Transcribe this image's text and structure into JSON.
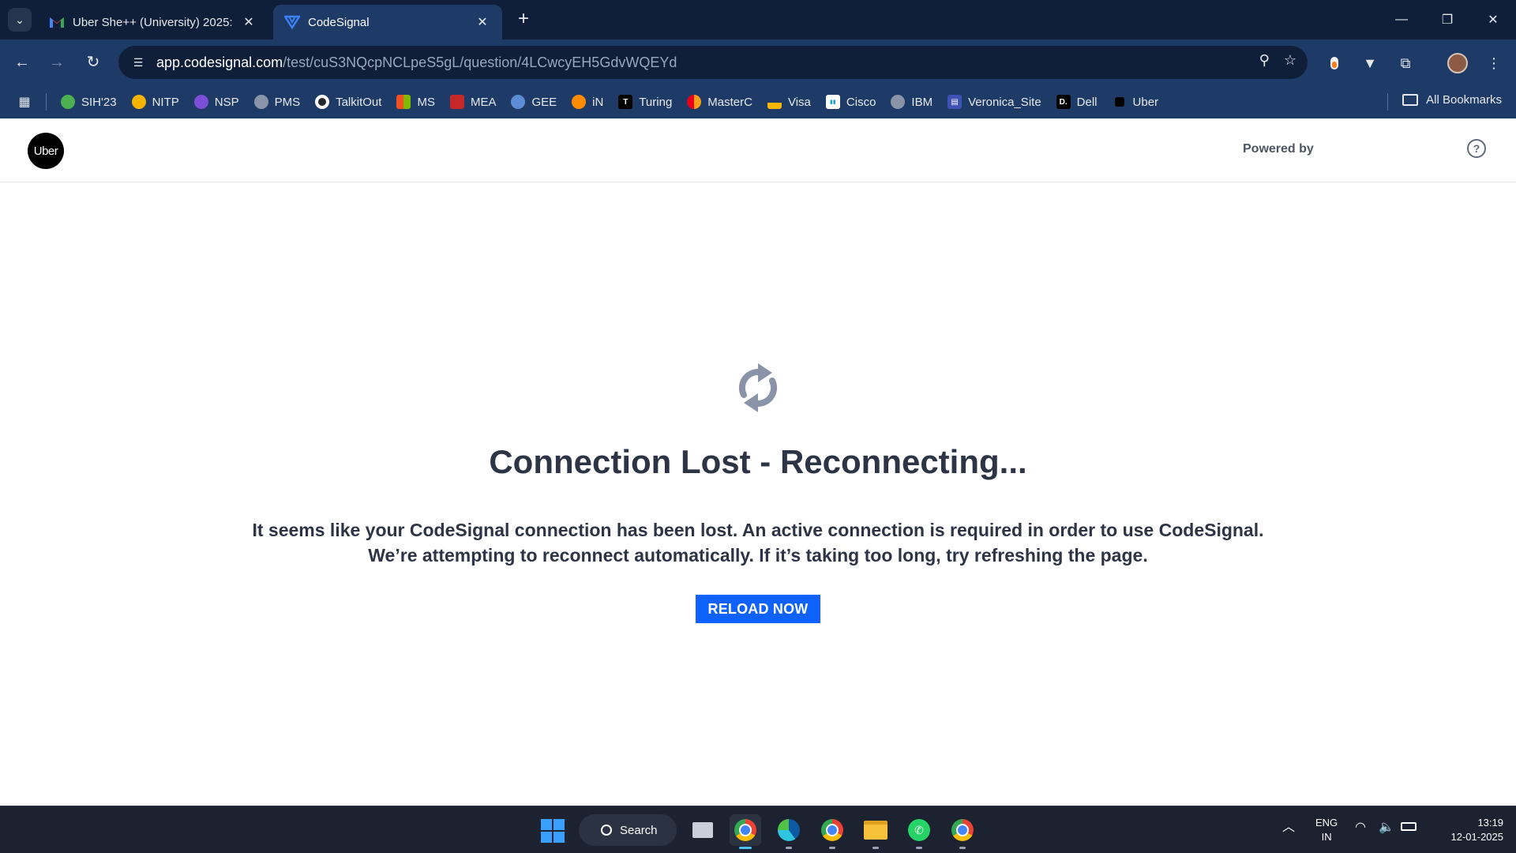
{
  "browser": {
    "tabs": [
      {
        "title": "Uber She++ (University) 2025: ",
        "active": false
      },
      {
        "title": "CodeSignal",
        "active": true
      }
    ],
    "url": {
      "host": "app.codesignal.com",
      "path": "/test/cuS3NQcpNCLpeS5gL/question/4LCwcyEH5GdvWQEYd"
    },
    "bookmarks": [
      {
        "label": "SIH'23",
        "color": "#4caf50"
      },
      {
        "label": "NITP",
        "color": "#f5b400"
      },
      {
        "label": "NSP",
        "color": "#7b4fd6"
      },
      {
        "label": "PMS",
        "color": "#8a94a8"
      },
      {
        "label": "TalkitOut",
        "color": "#24292e"
      },
      {
        "label": "MS",
        "color": "#f25022"
      },
      {
        "label": "MEA",
        "color": "#c62828"
      },
      {
        "label": "GEE",
        "color": "#5c8dd6"
      },
      {
        "label": "iN",
        "color": "#ff8c00"
      },
      {
        "label": "Turing",
        "color": "#000000"
      },
      {
        "label": "MasterC",
        "color": "#eb001b"
      },
      {
        "label": "Visa",
        "color": "#f7b600"
      },
      {
        "label": "Cisco",
        "color": "#1ba0d7"
      },
      {
        "label": "IBM",
        "color": "#8a94a8"
      },
      {
        "label": "Veronica_Site",
        "color": "#3f51b5"
      },
      {
        "label": "Dell",
        "color": "#000000"
      },
      {
        "label": "Uber",
        "color": "#000000"
      }
    ],
    "all_bookmarks": "All Bookmarks"
  },
  "page": {
    "logo_text": "Uber",
    "powered_by": "Powered by",
    "heading": "Connection Lost - Reconnecting...",
    "message_line1": "It seems like your CodeSignal connection has been lost. An active connection is required in order to use CodeSignal.",
    "message_line2": "We’re attempting to reconnect automatically. If it’s taking too long, try refreshing the page.",
    "reload_button": "RELOAD NOW",
    "accent_color": "#1062fe"
  },
  "taskbar": {
    "search_label": "Search",
    "language": "ENG",
    "region": "IN",
    "time": "13:19",
    "date": "12-01-2025"
  }
}
